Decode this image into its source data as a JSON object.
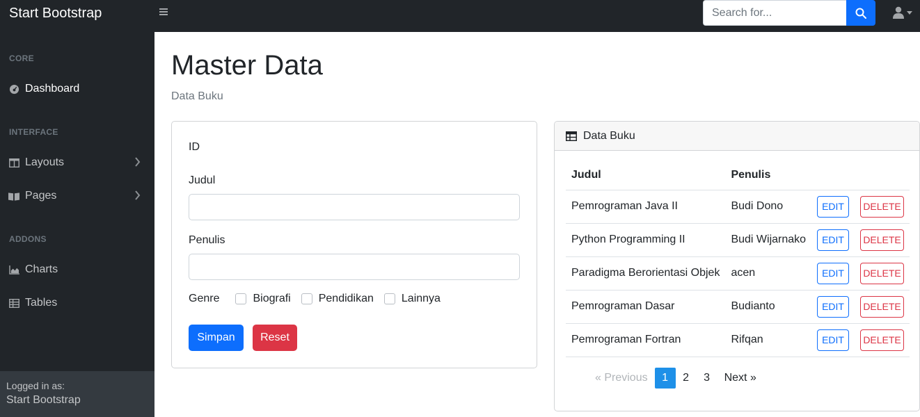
{
  "navbar": {
    "brand": "Start Bootstrap",
    "search_placeholder": "Search for..."
  },
  "sidebar": {
    "sections": [
      {
        "heading": "CORE"
      },
      {
        "heading": "INTERFACE"
      },
      {
        "heading": "ADDONS"
      }
    ],
    "items": [
      {
        "label": "Dashboard",
        "icon": "tachometer-icon"
      },
      {
        "label": "Layouts",
        "icon": "columns-icon"
      },
      {
        "label": "Pages",
        "icon": "book-open-icon"
      },
      {
        "label": "Charts",
        "icon": "chart-area-icon"
      },
      {
        "label": "Tables",
        "icon": "table-icon"
      }
    ],
    "footer": {
      "label": "Logged in as:",
      "name": "Start Bootstrap"
    }
  },
  "main": {
    "title": "Master Data",
    "subtitle": "Data Buku"
  },
  "form": {
    "id_label": "ID",
    "judul_label": "Judul",
    "judul_value": "",
    "penulis_label": "Penulis",
    "penulis_value": "",
    "genre_label": "Genre",
    "genres": [
      "Biografi",
      "Pendidikan",
      "Lainnya"
    ],
    "save_label": "Simpan",
    "reset_label": "Reset"
  },
  "table": {
    "title": "Data Buku",
    "columns": [
      "Judul",
      "Penulis"
    ],
    "rows": [
      {
        "judul": "Pemrograman Java II",
        "penulis": "Budi Dono"
      },
      {
        "judul": "Python Programming II",
        "penulis": "Budi Wijarnako"
      },
      {
        "judul": "Paradigma Berorientasi Objek",
        "penulis": "acen"
      },
      {
        "judul": "Pemrograman Dasar",
        "penulis": "Budianto"
      },
      {
        "judul": "Pemrograman Fortran",
        "penulis": "Rifqan"
      }
    ],
    "edit_label": "EDIT",
    "delete_label": "DELETE",
    "pagination": {
      "previous": "« Previous",
      "pages": [
        "1",
        "2",
        "3"
      ],
      "current": "1",
      "next": "Next »"
    }
  },
  "colors": {
    "primary": "#0d6efd",
    "danger": "#dc3545",
    "dark": "#212529",
    "pager_active": "#1e90e8"
  }
}
